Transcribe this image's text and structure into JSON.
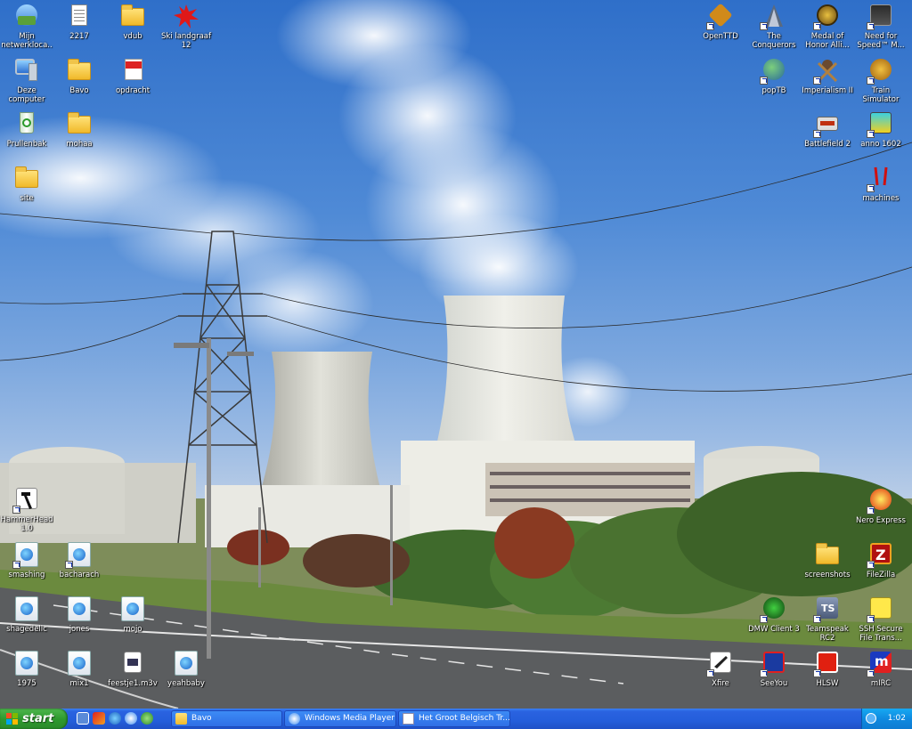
{
  "desktop": {
    "icons_left": [
      {
        "label": "Mijn netwerkloca...",
        "icon": "network-places-icon"
      },
      {
        "label": "2217",
        "icon": "document-icon"
      },
      {
        "label": "vdub",
        "icon": "folder-icon"
      },
      {
        "label": "Ski landgraaf 12",
        "icon": "red-splash-icon"
      },
      {
        "label": "Deze computer",
        "icon": "computer-icon"
      },
      {
        "label": "Bavo",
        "icon": "folder-icon"
      },
      {
        "label": "opdracht",
        "icon": "pdf-icon"
      },
      {
        "label": "Prullenbak",
        "icon": "recycle-bin-icon"
      },
      {
        "label": "mohaa",
        "icon": "folder-icon"
      },
      {
        "label": "site",
        "icon": "folder-icon"
      },
      {
        "label": "HammerHead 1.0",
        "icon": "hammer-icon"
      },
      {
        "label": "smashing",
        "icon": "media-file-icon"
      },
      {
        "label": "bacharach",
        "icon": "media-file-icon"
      },
      {
        "label": "shagedelic",
        "icon": "media-file-icon"
      },
      {
        "label": "jones",
        "icon": "media-file-icon"
      },
      {
        "label": "mojo",
        "icon": "media-file-icon"
      },
      {
        "label": "1975",
        "icon": "media-file-icon"
      },
      {
        "label": "mix1",
        "icon": "media-file-icon"
      },
      {
        "label": "feestje1.m3v",
        "icon": "playlist-icon"
      },
      {
        "label": "yeahbaby",
        "icon": "media-file-icon"
      }
    ],
    "icons_right": [
      {
        "label": "OpenTTD",
        "icon": "openttd-icon"
      },
      {
        "label": "The Conquerors",
        "icon": "conquerors-icon"
      },
      {
        "label": "Medal of Honor Alli...",
        "icon": "medal-icon"
      },
      {
        "label": "Need for Speed™ M...",
        "icon": "nfs-icon"
      },
      {
        "label": "popTB",
        "icon": "globe-icon"
      },
      {
        "label": "Imperialism II",
        "icon": "imperialism-icon"
      },
      {
        "label": "Train Simulator",
        "icon": "train-icon"
      },
      {
        "label": "Battlefield 2",
        "icon": "battlefield-icon"
      },
      {
        "label": "anno 1602",
        "icon": "anno-icon"
      },
      {
        "label": "machines",
        "icon": "machines-icon"
      },
      {
        "label": "Nero Express",
        "icon": "nero-icon"
      },
      {
        "label": "screenshots",
        "icon": "folder-icon"
      },
      {
        "label": "FileZilla",
        "icon": "filezilla-icon"
      },
      {
        "label": "DMW Client 3",
        "icon": "dmw-icon"
      },
      {
        "label": "Teamspeak RC2",
        "icon": "teamspeak-icon"
      },
      {
        "label": "SSH Secure File Trans...",
        "icon": "ssh-icon"
      },
      {
        "label": "Xfire",
        "icon": "xfire-icon"
      },
      {
        "label": "SeeYou",
        "icon": "seeyou-icon"
      },
      {
        "label": "HLSW",
        "icon": "hlsw-icon"
      },
      {
        "label": "mIRC",
        "icon": "mirc-icon"
      }
    ]
  },
  "taskbar": {
    "start_label": "start",
    "quick_launch": [
      "show-desktop-icon",
      "media-icon",
      "ie-icon",
      "wmp-icon",
      "messenger-icon"
    ],
    "tasks": [
      {
        "label": "Bavo",
        "icon": "folder-icon"
      },
      {
        "label": "Windows Media Player",
        "icon": "wmp-icon"
      },
      {
        "label": "Het Groot Belgisch Tr...",
        "icon": "document-icon"
      }
    ],
    "clock": "1:02"
  }
}
